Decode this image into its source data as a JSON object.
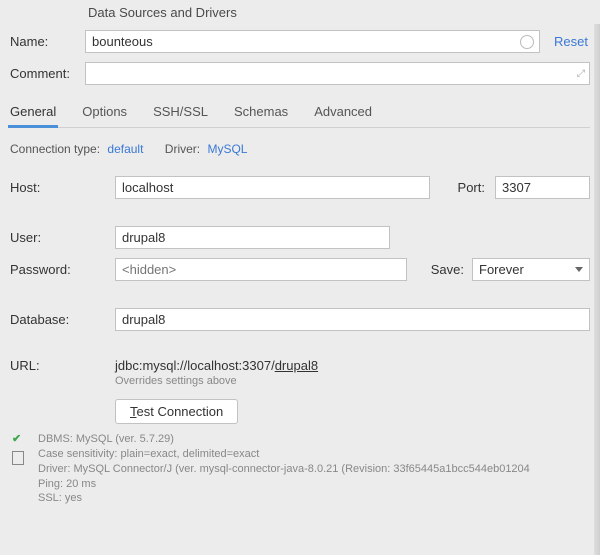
{
  "window": {
    "title": "Data Sources and Drivers"
  },
  "top": {
    "name_label": "Name:",
    "name_value": "bounteous",
    "reset": "Reset",
    "comment_label": "Comment:",
    "comment_value": ""
  },
  "tabs": {
    "general": "General",
    "options": "Options",
    "ssh": "SSH/SSL",
    "schemas": "Schemas",
    "advanced": "Advanced",
    "active": "general"
  },
  "conn": {
    "type_label": "Connection type:",
    "type_value": "default",
    "driver_label": "Driver:",
    "driver_value": "MySQL"
  },
  "form": {
    "host_label": "Host:",
    "host_value": "localhost",
    "port_label": "Port:",
    "port_value": "3307",
    "user_label": "User:",
    "user_value": "drupal8",
    "password_label": "Password:",
    "password_placeholder": "<hidden>",
    "save_label": "Save:",
    "save_value": "Forever",
    "database_label": "Database:",
    "database_value": "drupal8",
    "url_label": "URL:",
    "url_prefix": "jdbc:mysql://localhost:3307/",
    "url_db": "drupal8",
    "url_hint": "Overrides settings above"
  },
  "actions": {
    "test_prefix": "T",
    "test_rest": "est Connection"
  },
  "status": {
    "l1": "DBMS: MySQL (ver. 5.7.29)",
    "l2": "Case sensitivity: plain=exact, delimited=exact",
    "l3": "Driver: MySQL Connector/J (ver. mysql-connector-java-8.0.21 (Revision: 33f65445a1bcc544eb01204",
    "l4": "Ping: 20 ms",
    "l5": "SSL: yes"
  }
}
